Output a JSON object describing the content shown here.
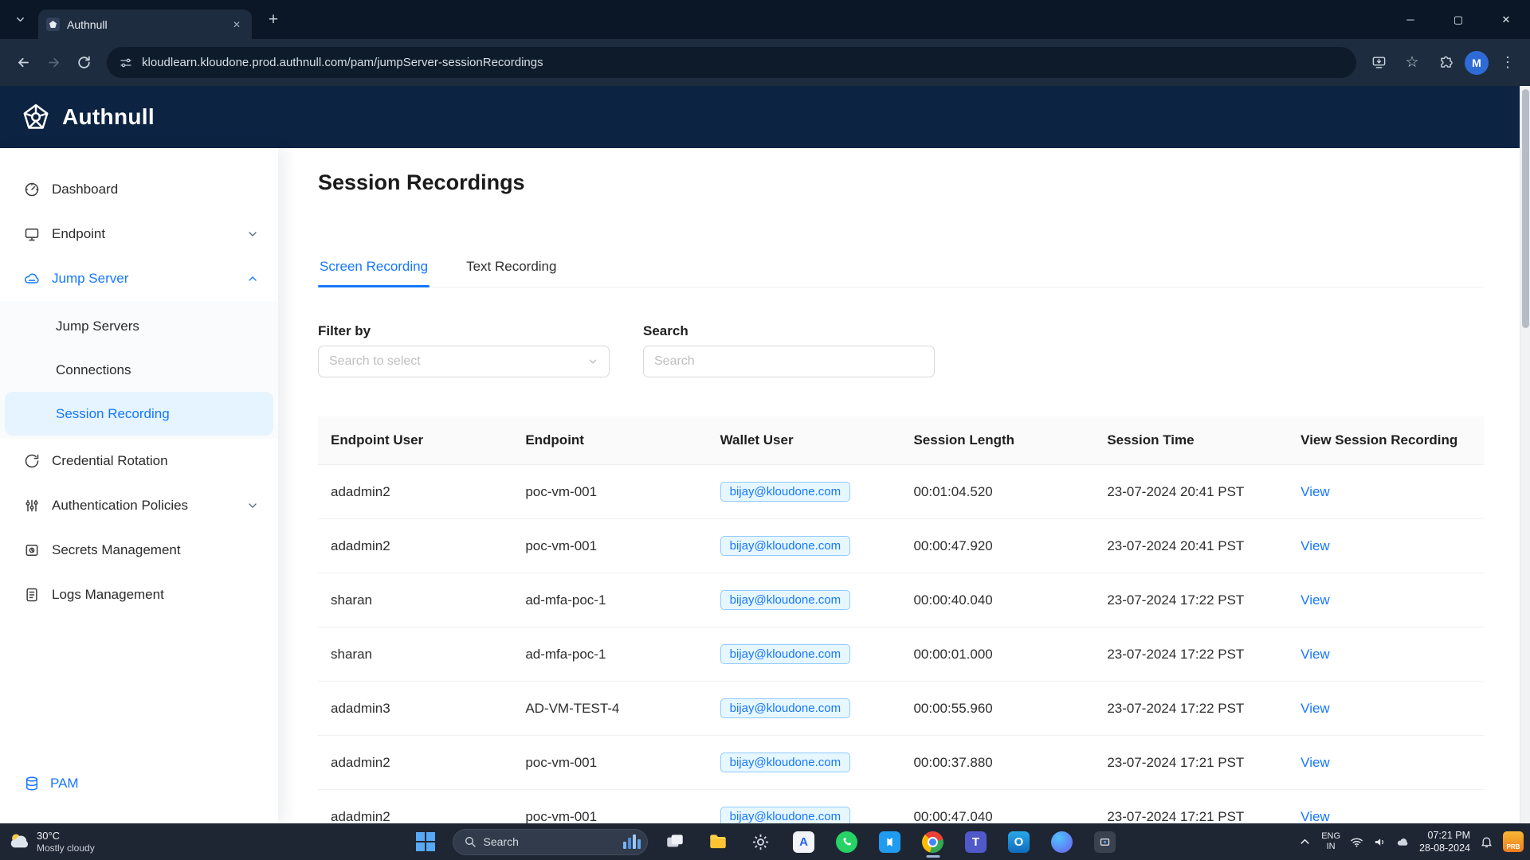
{
  "browser": {
    "tab_title": "Authnull",
    "url": "kloudlearn.kloudone.prod.authnull.com/pam/jumpServer-sessionRecordings",
    "avatar_letter": "M",
    "window_controls": {
      "minimize": "─",
      "maximize": "▢",
      "close": "✕"
    }
  },
  "app": {
    "brand": "Authnull"
  },
  "colors": {
    "accent": "#1677ff",
    "selected_bg": "#e6f4ff",
    "tag_bg": "#e6f7ff",
    "tag_border": "#91caff",
    "header_bg": "#0d2342"
  },
  "sidebar": {
    "items": [
      {
        "label": "Dashboard"
      },
      {
        "label": "Endpoint"
      },
      {
        "label": "Jump Server"
      },
      {
        "label": "Jump Servers"
      },
      {
        "label": "Connections"
      },
      {
        "label": "Session Recording"
      },
      {
        "label": "Credential Rotation"
      },
      {
        "label": "Authentication Policies"
      },
      {
        "label": "Secrets Management"
      },
      {
        "label": "Logs Management"
      }
    ],
    "footer": {
      "label": "PAM"
    }
  },
  "main": {
    "title": "Session Recordings",
    "tabs": [
      {
        "label": "Screen Recording"
      },
      {
        "label": "Text Recording"
      }
    ],
    "filter": {
      "label": "Filter by",
      "placeholder": "Search to select"
    },
    "search": {
      "label": "Search",
      "placeholder": "Search"
    }
  },
  "table": {
    "columns": [
      "Endpoint User",
      "Endpoint",
      "Wallet User",
      "Session Length",
      "Session Time",
      "View Session Recording"
    ],
    "rows": [
      {
        "endpoint_user": "adadmin2",
        "endpoint": "poc-vm-001",
        "wallet_user": "bijay@kloudone.com",
        "session_length": "00:01:04.520",
        "session_time": "23-07-2024 20:41 PST",
        "action": "View"
      },
      {
        "endpoint_user": "adadmin2",
        "endpoint": "poc-vm-001",
        "wallet_user": "bijay@kloudone.com",
        "session_length": "00:00:47.920",
        "session_time": "23-07-2024 20:41 PST",
        "action": "View"
      },
      {
        "endpoint_user": "sharan",
        "endpoint": "ad-mfa-poc-1",
        "wallet_user": "bijay@kloudone.com",
        "session_length": "00:00:40.040",
        "session_time": "23-07-2024 17:22 PST",
        "action": "View"
      },
      {
        "endpoint_user": "sharan",
        "endpoint": "ad-mfa-poc-1",
        "wallet_user": "bijay@kloudone.com",
        "session_length": "00:00:01.000",
        "session_time": "23-07-2024 17:22 PST",
        "action": "View"
      },
      {
        "endpoint_user": "adadmin3",
        "endpoint": "AD-VM-TEST-4",
        "wallet_user": "bijay@kloudone.com",
        "session_length": "00:00:55.960",
        "session_time": "23-07-2024 17:22 PST",
        "action": "View"
      },
      {
        "endpoint_user": "adadmin2",
        "endpoint": "poc-vm-001",
        "wallet_user": "bijay@kloudone.com",
        "session_length": "00:00:37.880",
        "session_time": "23-07-2024 17:21 PST",
        "action": "View"
      },
      {
        "endpoint_user": "adadmin2",
        "endpoint": "poc-vm-001",
        "wallet_user": "bijay@kloudone.com",
        "session_length": "00:00:47.040",
        "session_time": "23-07-2024 17:21 PST",
        "action": "View"
      }
    ]
  },
  "taskbar": {
    "weather": {
      "temp": "30°C",
      "condition": "Mostly cloudy"
    },
    "search_placeholder": "Search",
    "app_icons": [
      "task-view",
      "file-explorer",
      "settings",
      "app-a",
      "whatsapp",
      "vscode",
      "chrome",
      "teams",
      "outlook",
      "app-b",
      "screen-snip"
    ],
    "tray": {
      "lang_top": "ENG",
      "lang_bottom": "IN",
      "time": "07:21 PM",
      "date": "28-08-2024",
      "badge": "PRB"
    }
  }
}
